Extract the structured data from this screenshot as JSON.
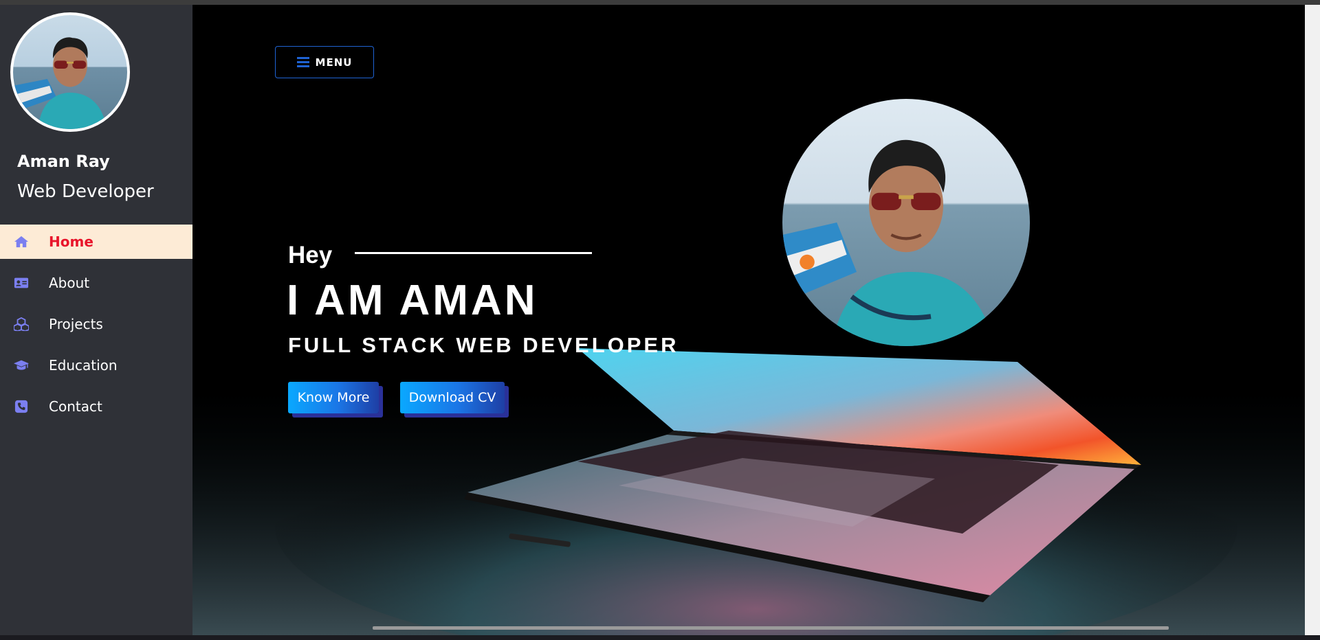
{
  "sidebar": {
    "name": "Aman Ray",
    "role": "Web Developer",
    "items": [
      {
        "label": "Home",
        "icon": "home-icon",
        "active": true
      },
      {
        "label": "About",
        "icon": "id-card-icon",
        "active": false
      },
      {
        "label": "Projects",
        "icon": "cubes-icon",
        "active": false
      },
      {
        "label": "Education",
        "icon": "graduation-cap-icon",
        "active": false
      },
      {
        "label": "Contact",
        "icon": "phone-icon",
        "active": false
      }
    ]
  },
  "hero": {
    "menu_label": "MENU",
    "greeting": "Hey",
    "title": "I AM AMAN",
    "subtitle": "FULL STACK WEB DEVELOPER",
    "know_more_label": "Know More",
    "download_cv_label": "Download CV"
  },
  "colors": {
    "sidebar_bg": "#2f3137",
    "active_item_bg": "#fdebd6",
    "active_item_text": "#e8152b",
    "icon_color": "#7b7ff0",
    "button_gradient_start": "#0aa8ff",
    "button_gradient_end": "#1e3fa5",
    "menu_border": "#1f63d4"
  }
}
